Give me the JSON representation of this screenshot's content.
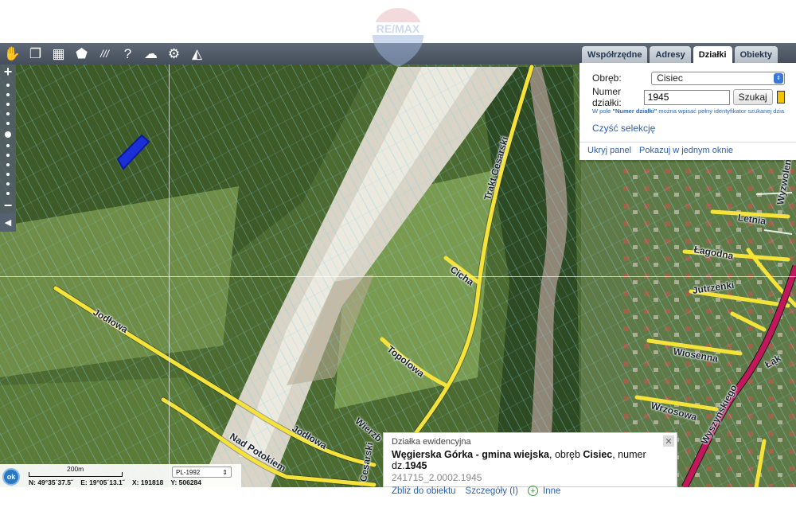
{
  "toolbar": {
    "tools": [
      {
        "icon": "pan-hand-icon",
        "glyph": "✋"
      },
      {
        "icon": "layers-icon",
        "glyph": "❐"
      },
      {
        "icon": "layout-icon",
        "glyph": "▦"
      },
      {
        "icon": "shape-icon",
        "glyph": "⬟"
      },
      {
        "icon": "measure-icon",
        "glyph": "///"
      },
      {
        "icon": "help-icon",
        "glyph": "?"
      },
      {
        "icon": "cloud-download-icon",
        "glyph": "☁"
      },
      {
        "icon": "settings-icon",
        "glyph": "⚙"
      },
      {
        "icon": "triangle-icon",
        "glyph": "◭"
      }
    ]
  },
  "zoom": {
    "in_label": "+",
    "out_label": "−",
    "collapse_glyph": "◀",
    "levels": 12,
    "active_level": 5
  },
  "panel": {
    "tabs": [
      "Współrzędne",
      "Adresy",
      "Działki",
      "Obiekty"
    ],
    "active_tab": 2,
    "obreb_label": "Obręb:",
    "obreb_value": "Cisiec",
    "numer_label": "Numer działki:",
    "numer_value": "1945",
    "search_label": "Szukaj",
    "hint_prefix": "W pole ",
    "hint_bold": "\"Numer działki\"",
    "hint_suffix": " można wpisać pełny identyfikator szukanej dzia",
    "clear_label": "Czyść selekcję",
    "hide_label": "Ukryj panel",
    "show_one_window_label": "Pokazuj w jednym oknie",
    "highlight_color": "#f2c500"
  },
  "streets": [
    {
      "name": "Jodłowa"
    },
    {
      "name": "Jodłowa"
    },
    {
      "name": "Nad Potokiem"
    },
    {
      "name": "Topolowa"
    },
    {
      "name": "Cicha"
    },
    {
      "name": "Trakt Cesarski"
    },
    {
      "name": "Cesarski"
    },
    {
      "name": "Wierzb"
    },
    {
      "name": "Letnia"
    },
    {
      "name": "Łagodna"
    },
    {
      "name": "Jutrzenki"
    },
    {
      "name": "Wiosenna"
    },
    {
      "name": "Wrzosowa"
    },
    {
      "name": "Wyzwolenia"
    },
    {
      "name": "Łąk"
    },
    {
      "name": "Wyszyńskiego"
    }
  ],
  "status": {
    "ok_label": "ok",
    "scale_label": "200m",
    "n": "N: 49°35´37.5˝",
    "e": "E: 19°05´13.1˝",
    "x": "X: 191818",
    "y": "Y: 506284",
    "crs": "PL-1992",
    "crs_caret": "⇕"
  },
  "popup": {
    "title": "Działka ewidencyjna",
    "place": "Węgierska Górka - gmina wiejska",
    "obreb_prefix": ", obręb ",
    "obreb": "Cisiec",
    "numer_prefix": ", numer dz.",
    "numer": "1945",
    "id": "241715_2.0002.1945",
    "zoom_link": "Zbliż do obiektu",
    "details_link": "Szczegóły (I)",
    "other_link": "Inne",
    "close_glyph": "✕"
  },
  "watermark": {
    "text": "RE/MAX"
  },
  "colors": {
    "road": "#f5e33a",
    "main_road": "#c2185b",
    "parcel_line": "#7fd3e8",
    "selected_parcel": "#1a2fd6",
    "toolbar": "#4e5866"
  }
}
